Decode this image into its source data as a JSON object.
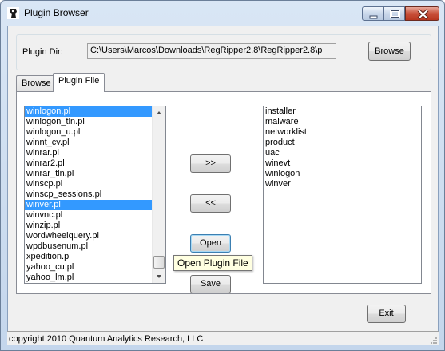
{
  "window": {
    "title": "Plugin Browser"
  },
  "plugin_dir": {
    "label": "Plugin Dir:",
    "value": "C:\\Users\\Marcos\\Downloads\\RegRipper2.8\\RegRipper2.8\\p",
    "browse_label": "Browse"
  },
  "tabs": [
    {
      "label": "Browse",
      "active": false
    },
    {
      "label": "Plugin File",
      "active": true
    }
  ],
  "plugins_list": {
    "items": [
      {
        "label": "winlogon.pl",
        "selected": true
      },
      {
        "label": "winlogon_tln.pl",
        "selected": false
      },
      {
        "label": "winlogon_u.pl",
        "selected": false
      },
      {
        "label": "winnt_cv.pl",
        "selected": false
      },
      {
        "label": "winrar.pl",
        "selected": false
      },
      {
        "label": "winrar2.pl",
        "selected": false
      },
      {
        "label": "winrar_tln.pl",
        "selected": false
      },
      {
        "label": "winscp.pl",
        "selected": false
      },
      {
        "label": "winscp_sessions.pl",
        "selected": false
      },
      {
        "label": "winver.pl",
        "selected": true
      },
      {
        "label": "winvnc.pl",
        "selected": false
      },
      {
        "label": "winzip.pl",
        "selected": false
      },
      {
        "label": "wordwheelquery.pl",
        "selected": false
      },
      {
        "label": "wpdbusenum.pl",
        "selected": false
      },
      {
        "label": "xpedition.pl",
        "selected": false
      },
      {
        "label": "yahoo_cu.pl",
        "selected": false
      },
      {
        "label": "yahoo_lm.pl",
        "selected": false
      }
    ]
  },
  "actions": {
    "add_label": ">>",
    "remove_label": "<<",
    "open_label": "Open",
    "save_label": "Save",
    "tooltip": "Open Plugin File"
  },
  "selected_list": {
    "items": [
      "installer",
      "malware",
      "networklist",
      "product",
      "uac",
      "winevt",
      "winlogon",
      "winver"
    ]
  },
  "exit_label": "Exit",
  "status": "copyright 2010 Quantum Analytics Research, LLC",
  "colors": {
    "selection": "#3399ff",
    "tooltip_bg": "#ffffe1",
    "title_gradient": "#d9e6f5"
  }
}
